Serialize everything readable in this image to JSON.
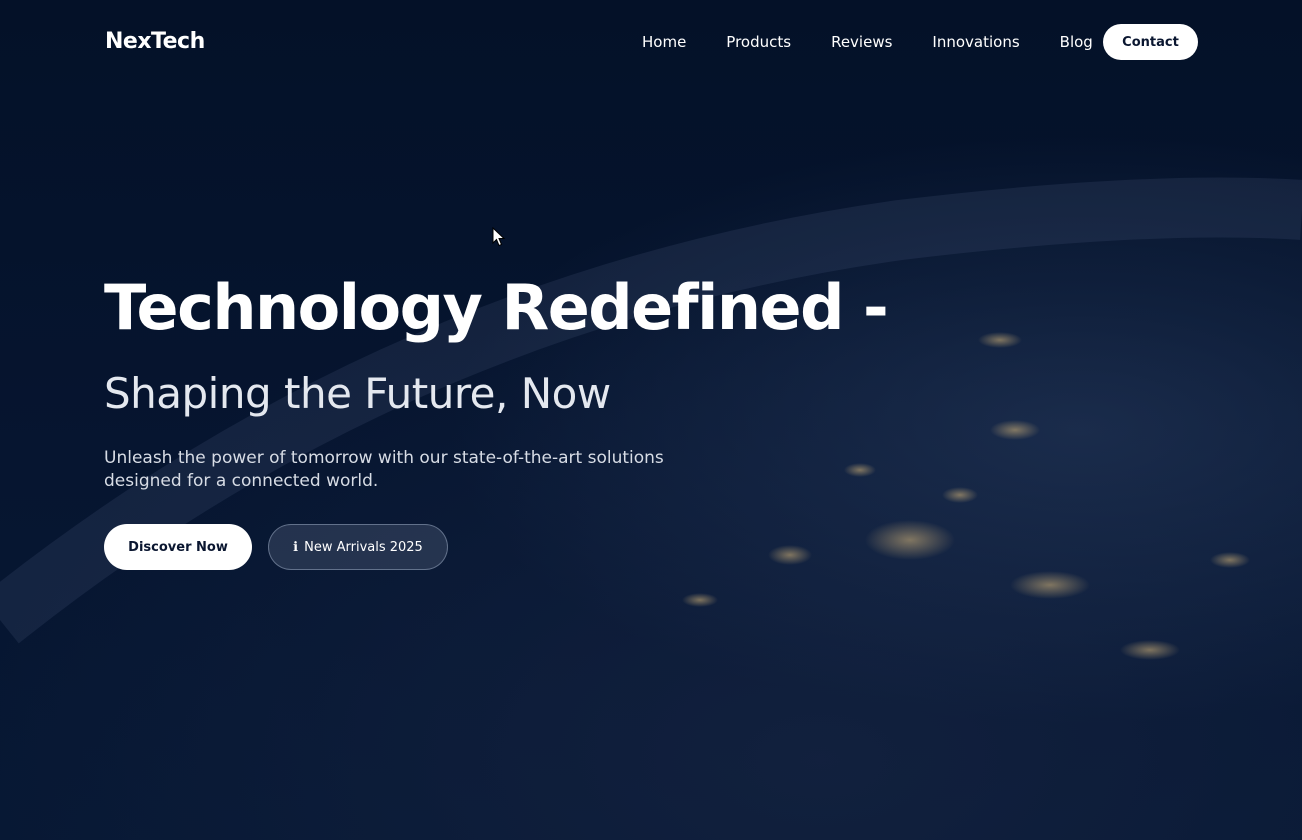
{
  "brand": {
    "name": "NexTech"
  },
  "nav": {
    "items": [
      {
        "label": "Home"
      },
      {
        "label": "Products"
      },
      {
        "label": "Reviews"
      },
      {
        "label": "Innovations"
      },
      {
        "label": "Blog"
      }
    ],
    "contact_label": "Contact"
  },
  "hero": {
    "headline": "Technology Redefined -",
    "subheadline": "Shaping the Future, Now",
    "description": "Unleash the power of tomorrow with our state-of-the-art solutions designed for a connected world.",
    "primary_button": "Discover Now",
    "secondary_button": {
      "icon": "info-icon",
      "icon_glyph": "ℹ",
      "label": "New Arrivals 2025"
    }
  },
  "colors": {
    "background": "#041128",
    "text": "#ffffff",
    "button_bg": "#ffffff",
    "button_text": "#0a1630"
  }
}
